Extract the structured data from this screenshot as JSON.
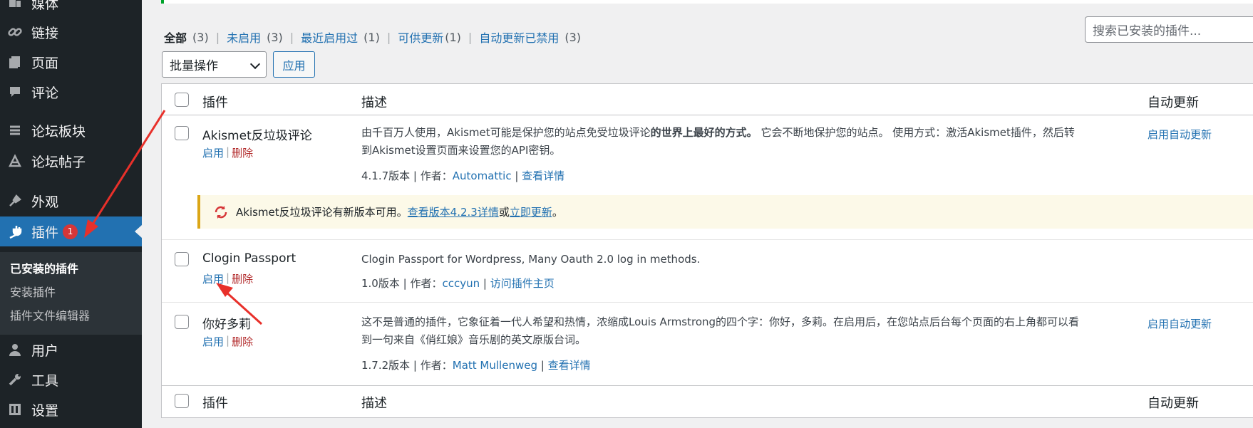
{
  "sidebar": {
    "items": [
      {
        "label": "媒体",
        "icon": "media-icon"
      },
      {
        "label": "链接",
        "icon": "link-icon"
      },
      {
        "label": "页面",
        "icon": "page-icon"
      },
      {
        "label": "评论",
        "icon": "comment-icon"
      },
      {
        "label": "论坛板块",
        "icon": "forum-icon"
      },
      {
        "label": "论坛帖子",
        "icon": "topics-icon"
      },
      {
        "label": "外观",
        "icon": "appearance-icon"
      },
      {
        "label": "插件",
        "icon": "plugin-icon",
        "badge": "1"
      },
      {
        "label": "用户",
        "icon": "user-icon"
      },
      {
        "label": "工具",
        "icon": "tools-icon"
      },
      {
        "label": "设置",
        "icon": "settings-icon"
      }
    ],
    "submenu": [
      "已安装的插件",
      "安装插件",
      "插件文件编辑器"
    ]
  },
  "filters": [
    {
      "label": "全部",
      "count": "(3)"
    },
    {
      "label": "未启用",
      "count": "(3)"
    },
    {
      "label": "最近启用过",
      "count": "(1)"
    },
    {
      "label": "可供更新",
      "count": "(1)"
    },
    {
      "label": "自动更新已禁用",
      "count": "(3)"
    }
  ],
  "search": {
    "placeholder": "搜索已安装的插件..."
  },
  "bulk": {
    "selected": "批量操作",
    "apply": "应用"
  },
  "table": {
    "columns": {
      "plugin": "插件",
      "description": "描述",
      "auto_update": "自动更新"
    },
    "plugins": [
      {
        "name": "Akismet反垃圾评论",
        "activate": "启用",
        "delete": "删除",
        "desc_line1": "由千百万人使用，Akismet可能是保护您的站点免受垃圾评论",
        "desc_bold": "的世界上最好的方式。",
        "desc_line1b": " 它会不断地保护您的站点。 使用方式：激活Akismet插件，然后转",
        "desc_line2": "到Akismet设置页面来设置您的API密钥。",
        "version": "4.1.7版本 | 作者：",
        "author": "Automattic",
        "sep": " | ",
        "details": "查看详情",
        "auto": "启用自动更新"
      },
      {
        "name": "Clogin Passport",
        "activate": "启用",
        "delete": "删除",
        "desc": "Clogin Passport for Wordpress, Many Oauth 2.0 log in methods.",
        "version": "1.0版本 | 作者：",
        "author": "cccyun",
        "sep": " | ",
        "details": "访问插件主页"
      },
      {
        "name": "你好多莉",
        "activate": "启用",
        "delete": "删除",
        "desc_line1": "这不是普通的插件，它象征着一代人希望和热情，浓缩成Louis Armstrong的四个字：你好，多莉。在启用后，在您站点后台每个页面的右上角都可以看",
        "desc_line2": "到一句来自《俏红娘》音乐剧的英文原版台词。",
        "version": "1.7.2版本 | 作者：",
        "author": "Matt Mullenweg",
        "sep": " | ",
        "details": "查看详情",
        "auto": "启用自动更新"
      }
    ]
  },
  "update_notice": {
    "text": "Akismet反垃圾评论有新版本可用。",
    "link1": "查看版本4.2.3详情",
    "or": "或",
    "link2": "立即更新",
    "end": "。"
  },
  "colors": {
    "accent": "#2271b1",
    "sidebar": "#1d2327",
    "annotation": "#e8302a",
    "badge": "#d63638"
  }
}
